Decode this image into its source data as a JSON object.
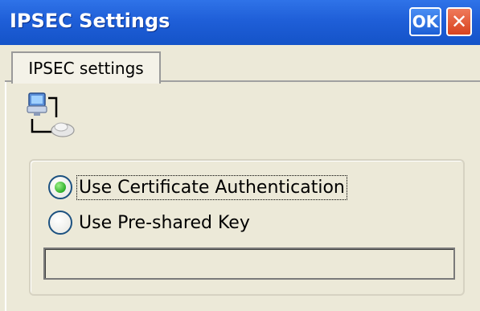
{
  "window": {
    "title": "IPSEC Settings",
    "ok_label": "OK",
    "close_label": "✕"
  },
  "tabs": [
    {
      "label": "IPSEC settings",
      "selected": true
    }
  ],
  "icon": {
    "name": "network-connection-icon"
  },
  "auth": {
    "options": [
      {
        "label": "Use Certificate Authentication",
        "checked": true
      },
      {
        "label": "Use Pre-shared Key",
        "checked": false
      }
    ],
    "preshared_key_value": "",
    "preshared_key_enabled": false
  },
  "colors": {
    "titlebar": "#1f5fd8",
    "close_button": "#d8431f",
    "dialog_bg": "#ece9d8",
    "radio_checked": "#2fb12a"
  }
}
